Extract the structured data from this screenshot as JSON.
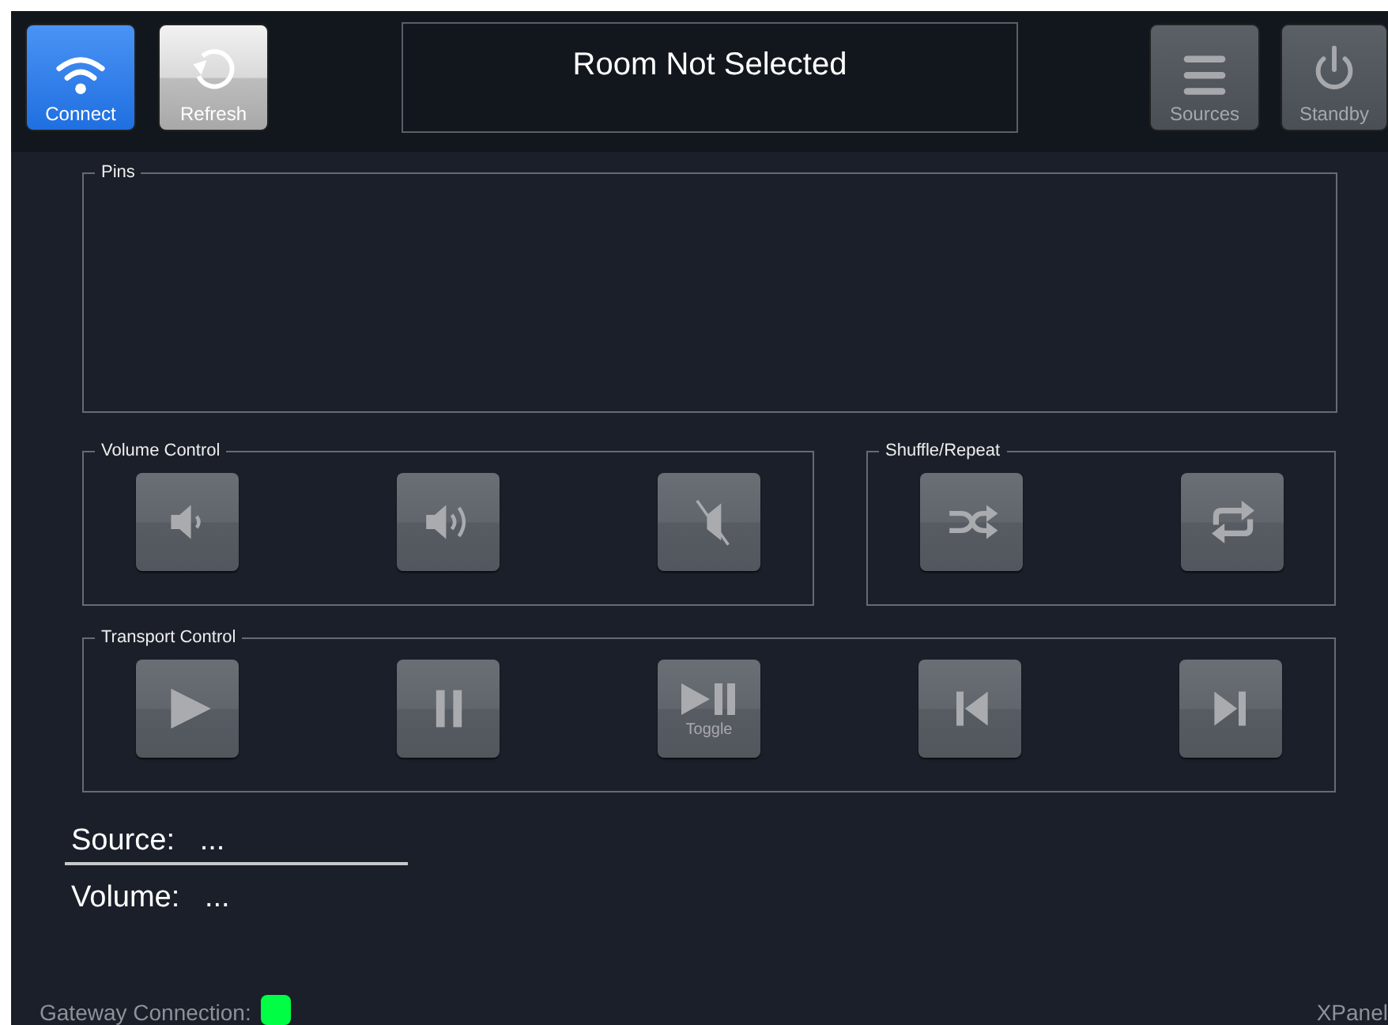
{
  "header": {
    "buttons": [
      {
        "label": "Connect",
        "kind": "wifi",
        "active": true,
        "disabled": false
      },
      {
        "label": "Refresh",
        "kind": "refresh",
        "active": false,
        "disabled": false
      }
    ],
    "room": "Room Not Selected",
    "right_buttons": [
      {
        "label": "Sources",
        "kind": "menu",
        "active": false,
        "disabled": true
      },
      {
        "label": "Standby",
        "kind": "power",
        "active": false,
        "disabled": true
      }
    ]
  },
  "pins": {
    "title": "Pins"
  },
  "volume_control": {
    "title": "Volume Control",
    "buttons": [
      {
        "kind": "volume-down"
      },
      {
        "kind": "volume-up"
      },
      {
        "kind": "mute"
      }
    ]
  },
  "shuffle_repeat": {
    "title": "Shuffle/Repeat",
    "buttons": [
      {
        "kind": "shuffle"
      },
      {
        "kind": "repeat"
      }
    ]
  },
  "transport_control": {
    "title": "Transport Control",
    "buttons": [
      {
        "kind": "play"
      },
      {
        "kind": "pause"
      },
      {
        "kind": "toggle",
        "label": "Toggle"
      },
      {
        "kind": "previous"
      },
      {
        "kind": "next"
      }
    ]
  },
  "info": [
    "Source:   ...",
    "Volume:   ..."
  ],
  "status_bar": {
    "gateway_label": "Gateway Connection:",
    "gateway_connected": true,
    "app_name": "XPanel"
  }
}
